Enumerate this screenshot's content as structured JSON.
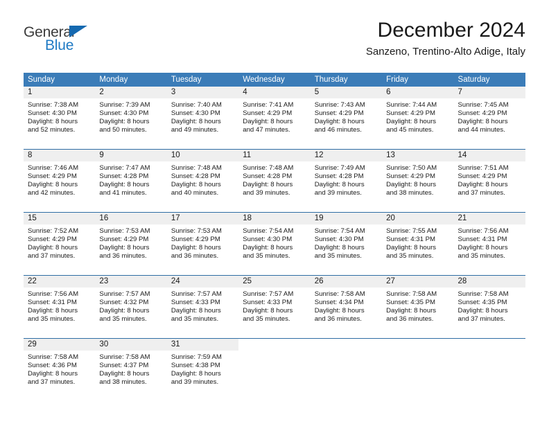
{
  "brand": {
    "name_part1": "General",
    "name_part2": "Blue",
    "triangle_icon": "triangle-icon",
    "color_dark": "#3b3b3b",
    "color_blue": "#1f7ac4"
  },
  "header": {
    "title": "December 2024",
    "subtitle": "Sanzeno, Trentino-Alto Adige, Italy"
  },
  "theme": {
    "header_bg": "#3b7cb8",
    "row_rule": "#2e6da4",
    "daynum_band": "#efefef",
    "text": "#1a1a1a"
  },
  "weekday_headers": [
    "Sunday",
    "Monday",
    "Tuesday",
    "Wednesday",
    "Thursday",
    "Friday",
    "Saturday"
  ],
  "weeks": [
    [
      {
        "day": "1",
        "sunrise": "Sunrise: 7:38 AM",
        "sunset": "Sunset: 4:30 PM",
        "daylight1": "Daylight: 8 hours",
        "daylight2": "and 52 minutes."
      },
      {
        "day": "2",
        "sunrise": "Sunrise: 7:39 AM",
        "sunset": "Sunset: 4:30 PM",
        "daylight1": "Daylight: 8 hours",
        "daylight2": "and 50 minutes."
      },
      {
        "day": "3",
        "sunrise": "Sunrise: 7:40 AM",
        "sunset": "Sunset: 4:30 PM",
        "daylight1": "Daylight: 8 hours",
        "daylight2": "and 49 minutes."
      },
      {
        "day": "4",
        "sunrise": "Sunrise: 7:41 AM",
        "sunset": "Sunset: 4:29 PM",
        "daylight1": "Daylight: 8 hours",
        "daylight2": "and 47 minutes."
      },
      {
        "day": "5",
        "sunrise": "Sunrise: 7:43 AM",
        "sunset": "Sunset: 4:29 PM",
        "daylight1": "Daylight: 8 hours",
        "daylight2": "and 46 minutes."
      },
      {
        "day": "6",
        "sunrise": "Sunrise: 7:44 AM",
        "sunset": "Sunset: 4:29 PM",
        "daylight1": "Daylight: 8 hours",
        "daylight2": "and 45 minutes."
      },
      {
        "day": "7",
        "sunrise": "Sunrise: 7:45 AM",
        "sunset": "Sunset: 4:29 PM",
        "daylight1": "Daylight: 8 hours",
        "daylight2": "and 44 minutes."
      }
    ],
    [
      {
        "day": "8",
        "sunrise": "Sunrise: 7:46 AM",
        "sunset": "Sunset: 4:29 PM",
        "daylight1": "Daylight: 8 hours",
        "daylight2": "and 42 minutes."
      },
      {
        "day": "9",
        "sunrise": "Sunrise: 7:47 AM",
        "sunset": "Sunset: 4:28 PM",
        "daylight1": "Daylight: 8 hours",
        "daylight2": "and 41 minutes."
      },
      {
        "day": "10",
        "sunrise": "Sunrise: 7:48 AM",
        "sunset": "Sunset: 4:28 PM",
        "daylight1": "Daylight: 8 hours",
        "daylight2": "and 40 minutes."
      },
      {
        "day": "11",
        "sunrise": "Sunrise: 7:48 AM",
        "sunset": "Sunset: 4:28 PM",
        "daylight1": "Daylight: 8 hours",
        "daylight2": "and 39 minutes."
      },
      {
        "day": "12",
        "sunrise": "Sunrise: 7:49 AM",
        "sunset": "Sunset: 4:28 PM",
        "daylight1": "Daylight: 8 hours",
        "daylight2": "and 39 minutes."
      },
      {
        "day": "13",
        "sunrise": "Sunrise: 7:50 AM",
        "sunset": "Sunset: 4:29 PM",
        "daylight1": "Daylight: 8 hours",
        "daylight2": "and 38 minutes."
      },
      {
        "day": "14",
        "sunrise": "Sunrise: 7:51 AM",
        "sunset": "Sunset: 4:29 PM",
        "daylight1": "Daylight: 8 hours",
        "daylight2": "and 37 minutes."
      }
    ],
    [
      {
        "day": "15",
        "sunrise": "Sunrise: 7:52 AM",
        "sunset": "Sunset: 4:29 PM",
        "daylight1": "Daylight: 8 hours",
        "daylight2": "and 37 minutes."
      },
      {
        "day": "16",
        "sunrise": "Sunrise: 7:53 AM",
        "sunset": "Sunset: 4:29 PM",
        "daylight1": "Daylight: 8 hours",
        "daylight2": "and 36 minutes."
      },
      {
        "day": "17",
        "sunrise": "Sunrise: 7:53 AM",
        "sunset": "Sunset: 4:29 PM",
        "daylight1": "Daylight: 8 hours",
        "daylight2": "and 36 minutes."
      },
      {
        "day": "18",
        "sunrise": "Sunrise: 7:54 AM",
        "sunset": "Sunset: 4:30 PM",
        "daylight1": "Daylight: 8 hours",
        "daylight2": "and 35 minutes."
      },
      {
        "day": "19",
        "sunrise": "Sunrise: 7:54 AM",
        "sunset": "Sunset: 4:30 PM",
        "daylight1": "Daylight: 8 hours",
        "daylight2": "and 35 minutes."
      },
      {
        "day": "20",
        "sunrise": "Sunrise: 7:55 AM",
        "sunset": "Sunset: 4:31 PM",
        "daylight1": "Daylight: 8 hours",
        "daylight2": "and 35 minutes."
      },
      {
        "day": "21",
        "sunrise": "Sunrise: 7:56 AM",
        "sunset": "Sunset: 4:31 PM",
        "daylight1": "Daylight: 8 hours",
        "daylight2": "and 35 minutes."
      }
    ],
    [
      {
        "day": "22",
        "sunrise": "Sunrise: 7:56 AM",
        "sunset": "Sunset: 4:31 PM",
        "daylight1": "Daylight: 8 hours",
        "daylight2": "and 35 minutes."
      },
      {
        "day": "23",
        "sunrise": "Sunrise: 7:57 AM",
        "sunset": "Sunset: 4:32 PM",
        "daylight1": "Daylight: 8 hours",
        "daylight2": "and 35 minutes."
      },
      {
        "day": "24",
        "sunrise": "Sunrise: 7:57 AM",
        "sunset": "Sunset: 4:33 PM",
        "daylight1": "Daylight: 8 hours",
        "daylight2": "and 35 minutes."
      },
      {
        "day": "25",
        "sunrise": "Sunrise: 7:57 AM",
        "sunset": "Sunset: 4:33 PM",
        "daylight1": "Daylight: 8 hours",
        "daylight2": "and 35 minutes."
      },
      {
        "day": "26",
        "sunrise": "Sunrise: 7:58 AM",
        "sunset": "Sunset: 4:34 PM",
        "daylight1": "Daylight: 8 hours",
        "daylight2": "and 36 minutes."
      },
      {
        "day": "27",
        "sunrise": "Sunrise: 7:58 AM",
        "sunset": "Sunset: 4:35 PM",
        "daylight1": "Daylight: 8 hours",
        "daylight2": "and 36 minutes."
      },
      {
        "day": "28",
        "sunrise": "Sunrise: 7:58 AM",
        "sunset": "Sunset: 4:35 PM",
        "daylight1": "Daylight: 8 hours",
        "daylight2": "and 37 minutes."
      }
    ],
    [
      {
        "day": "29",
        "sunrise": "Sunrise: 7:58 AM",
        "sunset": "Sunset: 4:36 PM",
        "daylight1": "Daylight: 8 hours",
        "daylight2": "and 37 minutes."
      },
      {
        "day": "30",
        "sunrise": "Sunrise: 7:58 AM",
        "sunset": "Sunset: 4:37 PM",
        "daylight1": "Daylight: 8 hours",
        "daylight2": "and 38 minutes."
      },
      {
        "day": "31",
        "sunrise": "Sunrise: 7:59 AM",
        "sunset": "Sunset: 4:38 PM",
        "daylight1": "Daylight: 8 hours",
        "daylight2": "and 39 minutes."
      },
      {
        "day": "",
        "sunrise": "",
        "sunset": "",
        "daylight1": "",
        "daylight2": ""
      },
      {
        "day": "",
        "sunrise": "",
        "sunset": "",
        "daylight1": "",
        "daylight2": ""
      },
      {
        "day": "",
        "sunrise": "",
        "sunset": "",
        "daylight1": "",
        "daylight2": ""
      },
      {
        "day": "",
        "sunrise": "",
        "sunset": "",
        "daylight1": "",
        "daylight2": ""
      }
    ]
  ]
}
